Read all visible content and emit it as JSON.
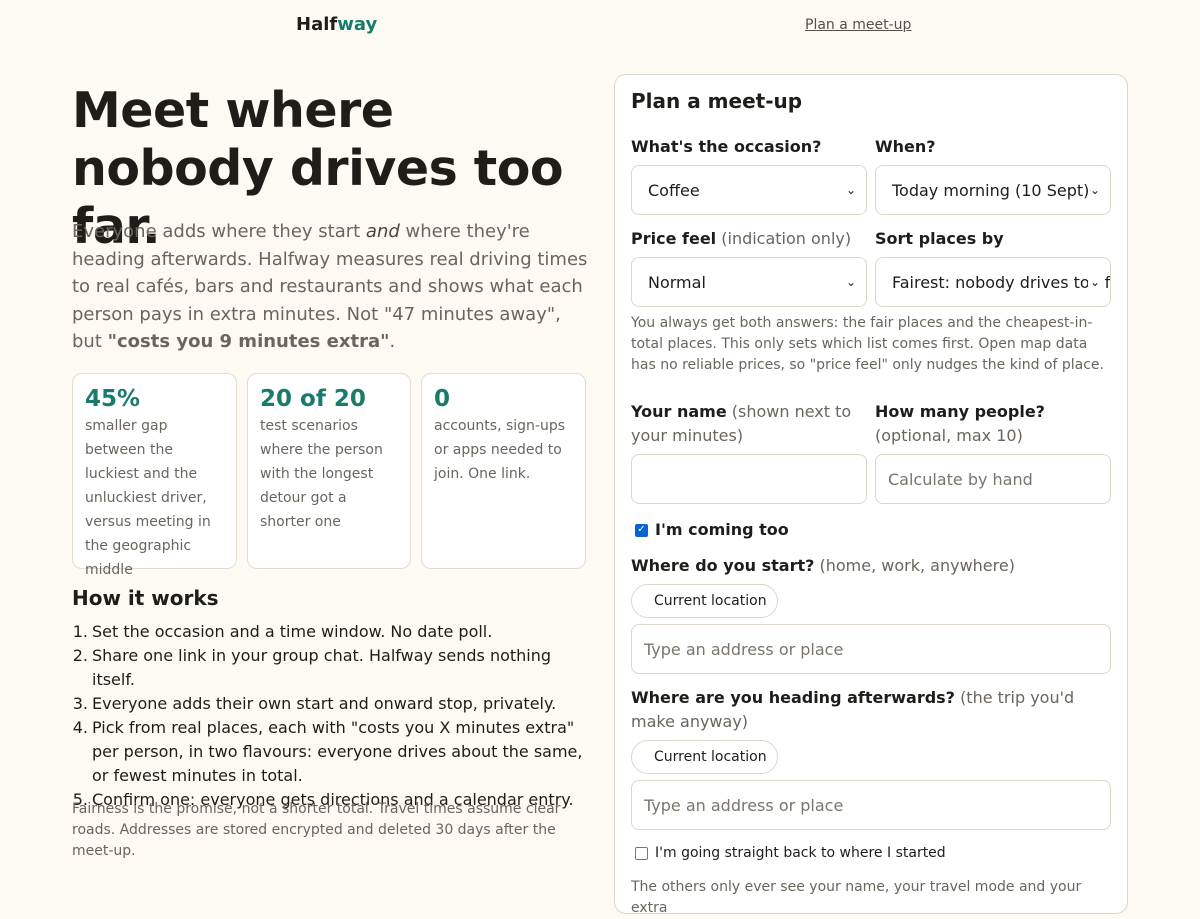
{
  "header": {
    "logo_part1": "Half",
    "logo_part2": "way",
    "nav_link": "Plan a meet-up"
  },
  "hero": {
    "title": "Meet where nobody drives too far.",
    "intro_1": "Everyone adds where they start ",
    "intro_em": "and",
    "intro_2": " where they're heading afterwards. Halfway measures real driving times to real cafés, bars and restaurants and shows what each person pays in extra minutes. Not \"47 minutes away\", but ",
    "intro_strong": "\"costs you 9 minutes extra\"",
    "intro_end": "."
  },
  "stats": [
    {
      "value": "45%",
      "desc": "smaller gap between the luckiest and the unluckiest driver, versus meeting in the geographic middle"
    },
    {
      "value": "20 of 20",
      "desc": "test scenarios where the person with the longest detour got a shorter one"
    },
    {
      "value": "0",
      "desc": "accounts, sign-ups or apps needed to join. One link."
    }
  ],
  "how_it_works": {
    "title": "How it works",
    "steps": [
      "Set the occasion and a time window. No date poll.",
      "Share one link in your group chat. Halfway sends nothing itself.",
      "Everyone adds their own start and onward stop, privately.",
      "Pick from real places, each with \"costs you X minutes extra\" per person, in two flavours: everyone drives about the same, or fewest minutes in total.",
      "Confirm one: everyone gets directions and a calendar entry."
    ],
    "footnote": "Fairness is the promise, not a shorter total. Travel times assume clear roads. Addresses are stored encrypted and deleted 30 days after the meet-up."
  },
  "form": {
    "title": "Plan a meet-up",
    "occasion_label": "What's the occasion?",
    "occasion_value": "Coffee",
    "when_label": "When?",
    "when_value": "Today morning (10 Sept)",
    "price_label": "Price feel",
    "price_hint": "(indication only)",
    "price_value": "Normal",
    "sort_label": "Sort places by",
    "sort_value": "Fairest: nobody drives too far",
    "help_text": "You always get both answers: the fair places and the cheapest-in-total places. This only sets which list comes first. Open map data has no reliable prices, so \"price feel\" only nudges the kind of place.",
    "name_label": "Your name",
    "name_hint": "(shown next to your minutes)",
    "name_value": "",
    "people_label": "How many people?",
    "people_hint": "(optional, max 10)",
    "people_placeholder": "Calculate by hand",
    "coming_label": "I'm coming too",
    "coming_checked": true,
    "start_label": "Where do you start?",
    "start_hint": "(home, work, anywhere)",
    "start_location_btn": "Current location",
    "start_placeholder": "Type an address or place",
    "dest_label": "Where are you heading afterwards?",
    "dest_hint": "(the trip you'd make anyway)",
    "dest_location_btn": "Current location",
    "dest_placeholder": "Type an address or place",
    "return_label": "I'm going straight back to where I started",
    "return_checked": false,
    "bottom_note": "The others only ever see your name, your travel mode and your extra"
  },
  "colors": {
    "accent": "#1a7a6c",
    "background": "#fdf9f3",
    "checkbox": "#0a63d2"
  }
}
